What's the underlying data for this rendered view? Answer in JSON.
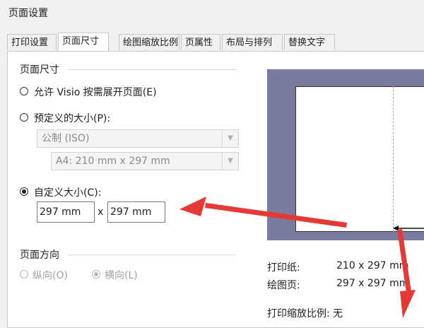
{
  "window": {
    "title": "页面设置"
  },
  "tabs": [
    {
      "label": "打印设置"
    },
    {
      "label": "页面尺寸"
    },
    {
      "label": "绘图缩放比例"
    },
    {
      "label": "页属性"
    },
    {
      "label": "布局与排列"
    },
    {
      "label": "替换文字"
    }
  ],
  "page_size": {
    "group_label": "页面尺寸",
    "option_expand": "允许 Visio 按需展开页面(E)",
    "option_predefined": "预定义的大小(P):",
    "predefined_standard": "公制 (ISO)",
    "predefined_paper": "A4:  210 mm x 297 mm",
    "option_custom": "自定义大小(C):",
    "custom_width": "297 mm",
    "times_sign": "x",
    "custom_height": "297 mm",
    "selected": "custom"
  },
  "orientation": {
    "group_label": "页面方向",
    "portrait": "纵向(O)",
    "landscape": "横向(L)",
    "selected": "landscape",
    "enabled": false
  },
  "preview": {
    "printer_paper_label": "打印纸:",
    "printer_paper_value": "210 x 297 mm",
    "drawing_page_label": "绘图页:",
    "drawing_page_value": "297 x 297 mm",
    "print_zoom_label": "打印缩放比例: 无"
  },
  "colors": {
    "preview_background": "#7b7a9f",
    "annotation_arrow": "#e53935"
  }
}
